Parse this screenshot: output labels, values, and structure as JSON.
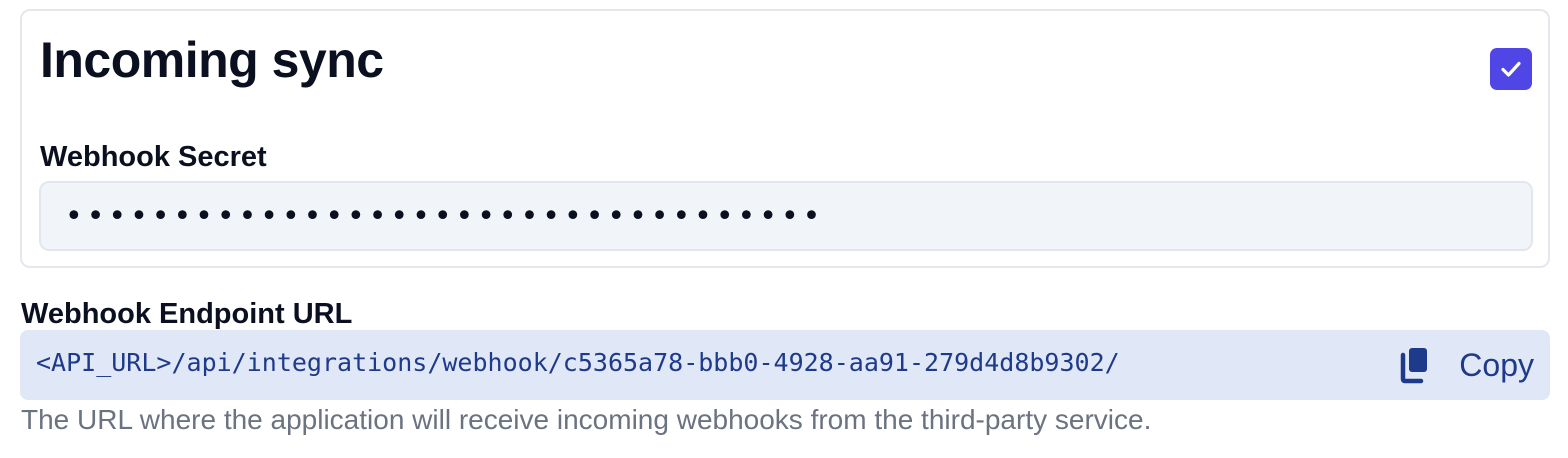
{
  "incoming_sync": {
    "title": "Incoming sync",
    "enabled": true,
    "webhook_secret": {
      "label": "Webhook Secret",
      "masked_value": "•••••••••••••••••••••••••••••••••••"
    }
  },
  "webhook_endpoint": {
    "label": "Webhook Endpoint URL",
    "url": "<API_URL>/api/integrations/webhook/c5365a78-bbb0-4928-aa91-279d4d8b9302/",
    "copy_label": "Copy",
    "help_text": "The URL where the application will receive incoming webhooks from the third-party service."
  },
  "colors": {
    "accent": "#4f46e5",
    "url_text": "#1e3a8a",
    "url_background": "#e0e7f7",
    "secret_background": "#f1f4f9"
  },
  "icons": {
    "checkbox": "checkmark-icon",
    "copy": "copy-icon"
  }
}
